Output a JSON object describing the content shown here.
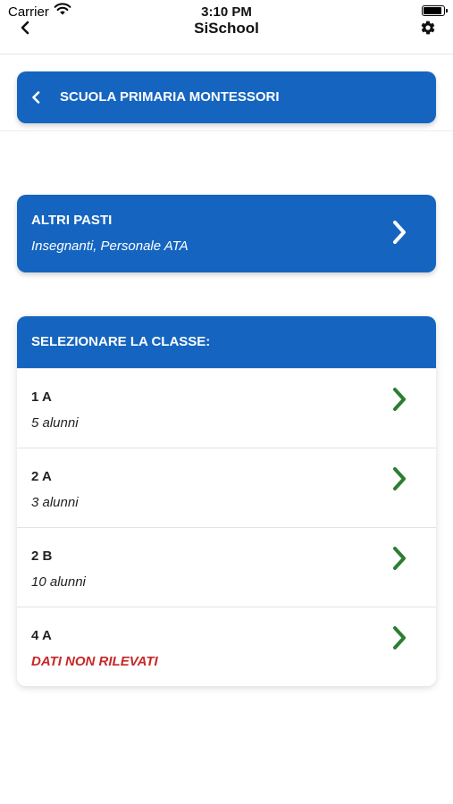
{
  "status_bar": {
    "carrier": "Carrier",
    "time": "3:10 PM"
  },
  "nav": {
    "title": "SiSchool"
  },
  "school": {
    "name": "SCUOLA PRIMARIA MONTESSORI"
  },
  "altri_pasti": {
    "title": "ALTRI PASTI",
    "subtitle": "Insegnanti, Personale ATA"
  },
  "classes": {
    "header": "SELEZIONARE LA CLASSE:",
    "items": [
      {
        "name": "1 A",
        "detail": "5 alunni"
      },
      {
        "name": "2 A",
        "detail": "3 alunni"
      },
      {
        "name": "2 B",
        "detail": "10 alunni"
      },
      {
        "name": "4 A",
        "detail": "DATI NON RILEVATI"
      }
    ]
  },
  "colors": {
    "primary_blue": "#1565c0",
    "chevron_green": "#2e7d32",
    "alert_red": "#c62828"
  },
  "icons": [
    "wifi-icon",
    "battery-icon",
    "back-chevron-icon",
    "gear-icon",
    "chevron-right-icon"
  ]
}
